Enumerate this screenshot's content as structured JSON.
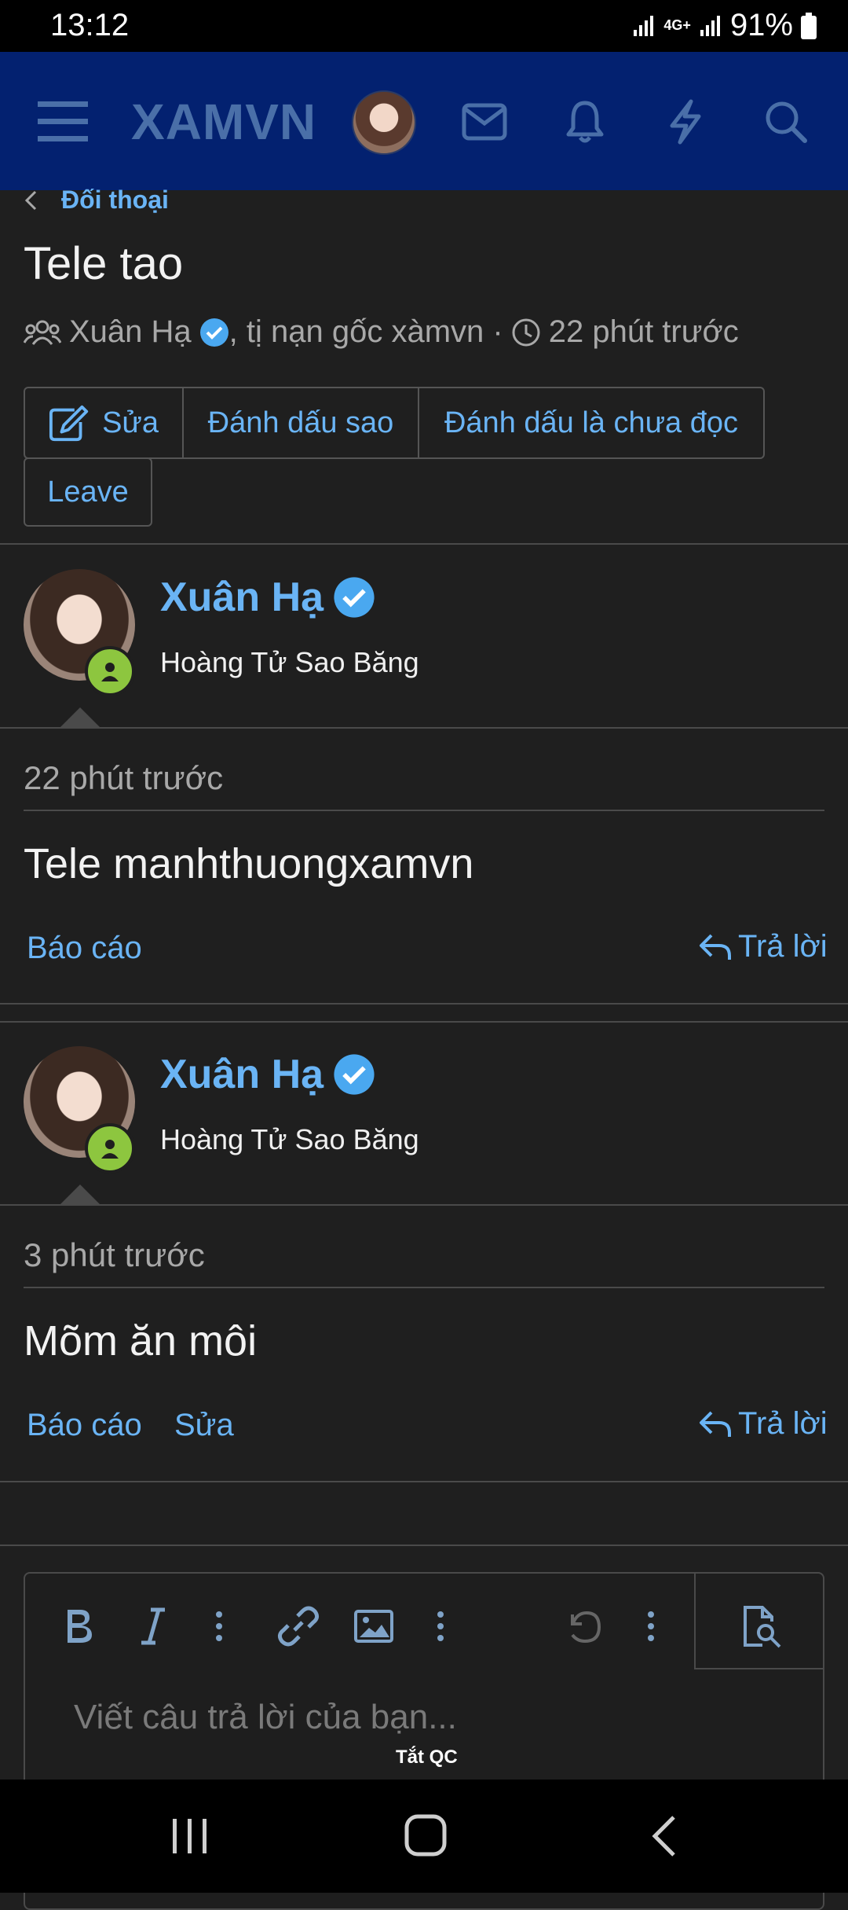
{
  "status": {
    "time": "13:12",
    "network": "4G+",
    "battery": "91%"
  },
  "header": {
    "logo": "XAMVN"
  },
  "breadcrumb": {
    "label": "Đối thoại"
  },
  "conversation": {
    "title": "Tele tao",
    "participants": "Xuân Hạ",
    "participants_rest": ", tị nạn gốc xàmvn ·",
    "time": "22 phút trước"
  },
  "actions": {
    "edit": "Sửa",
    "star": "Đánh dấu sao",
    "unread": "Đánh dấu là chưa đọc",
    "leave": "Leave"
  },
  "messages": [
    {
      "author": "Xuân Hạ",
      "user_title": "Hoàng Tử Sao Băng",
      "time": "22 phút trước",
      "text": "Tele manhthuongxamvn",
      "report": "Báo cáo",
      "reply": "Trả lời"
    },
    {
      "author": "Xuân Hạ",
      "user_title": "Hoàng Tử Sao Băng",
      "time": "3 phút trước",
      "text": "Mõm ăn môi",
      "report": "Báo cáo",
      "edit": "Sửa",
      "reply": "Trả lời"
    }
  ],
  "editor": {
    "placeholder": "Viết câu trả lời của bạn..."
  },
  "ad": {
    "label": "Tắt QC"
  },
  "colors": {
    "header_bg": "#032170",
    "accent": "#6ab4f5",
    "online": "#8dc63f",
    "page_bg": "#1f1f1f"
  }
}
